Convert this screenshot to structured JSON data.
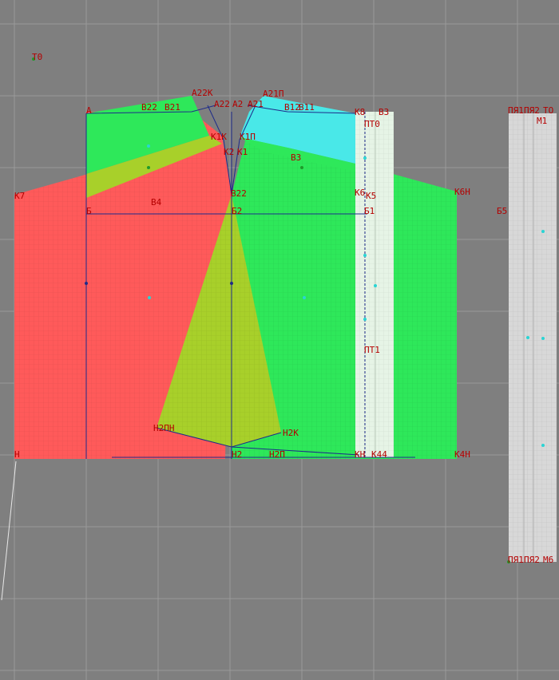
{
  "colors": {
    "background": "#7f7f7f",
    "grid_major": "#9a9a9a",
    "grid_minor": "#8a8a8a",
    "label": "#b40000",
    "construction_line": "#1e2b8a",
    "back_panel": "#ff5a5a",
    "front_panel": "#2ee85a",
    "dart_yellow": "#a8d02a",
    "cyan_panel": "#49e8e8",
    "strip_light": "#e6f4e6",
    "strip_gray": "#d8d8d8",
    "point": "#2ad4d4",
    "point_green": "#1f9a2a"
  },
  "labels": {
    "T0": "T0",
    "A": "A",
    "B22": "В22",
    "B21": "В21",
    "A22K": "A22K",
    "A22": "A22",
    "A2": "A2",
    "A21": "A21",
    "A21P": "A21П",
    "B12": "В12",
    "B11": "В11",
    "K8": "K8",
    "B3a": "B3",
    "PT0": "ПТ0",
    "K1K": "K1K",
    "K1P": "K1П",
    "K2": "K2",
    "K1": "K1",
    "B3": "B3",
    "K7": "K7",
    "B22b": "B22",
    "K6": "K6",
    "K5": "K5",
    "K6H": "K6H",
    "B": "Б",
    "B4": "B4",
    "B2": "Б2",
    "B1": "Б1",
    "B5": "Б5",
    "PT1": "ПТ1",
    "H2PH": "H2ПH",
    "H2K": "H2K",
    "H": "H",
    "H2": "H2",
    "H2P": "H2П",
    "K4H": "K4H",
    "K44": "K44",
    "KH": "KH",
    "PYA1": "ПЯ1",
    "PYA2": "ПЯ2",
    "TO": "ТО",
    "M1": "M1",
    "PYA1b": "ПЯ1",
    "PYA2b": "ПЯ2",
    "M6": "M6"
  }
}
